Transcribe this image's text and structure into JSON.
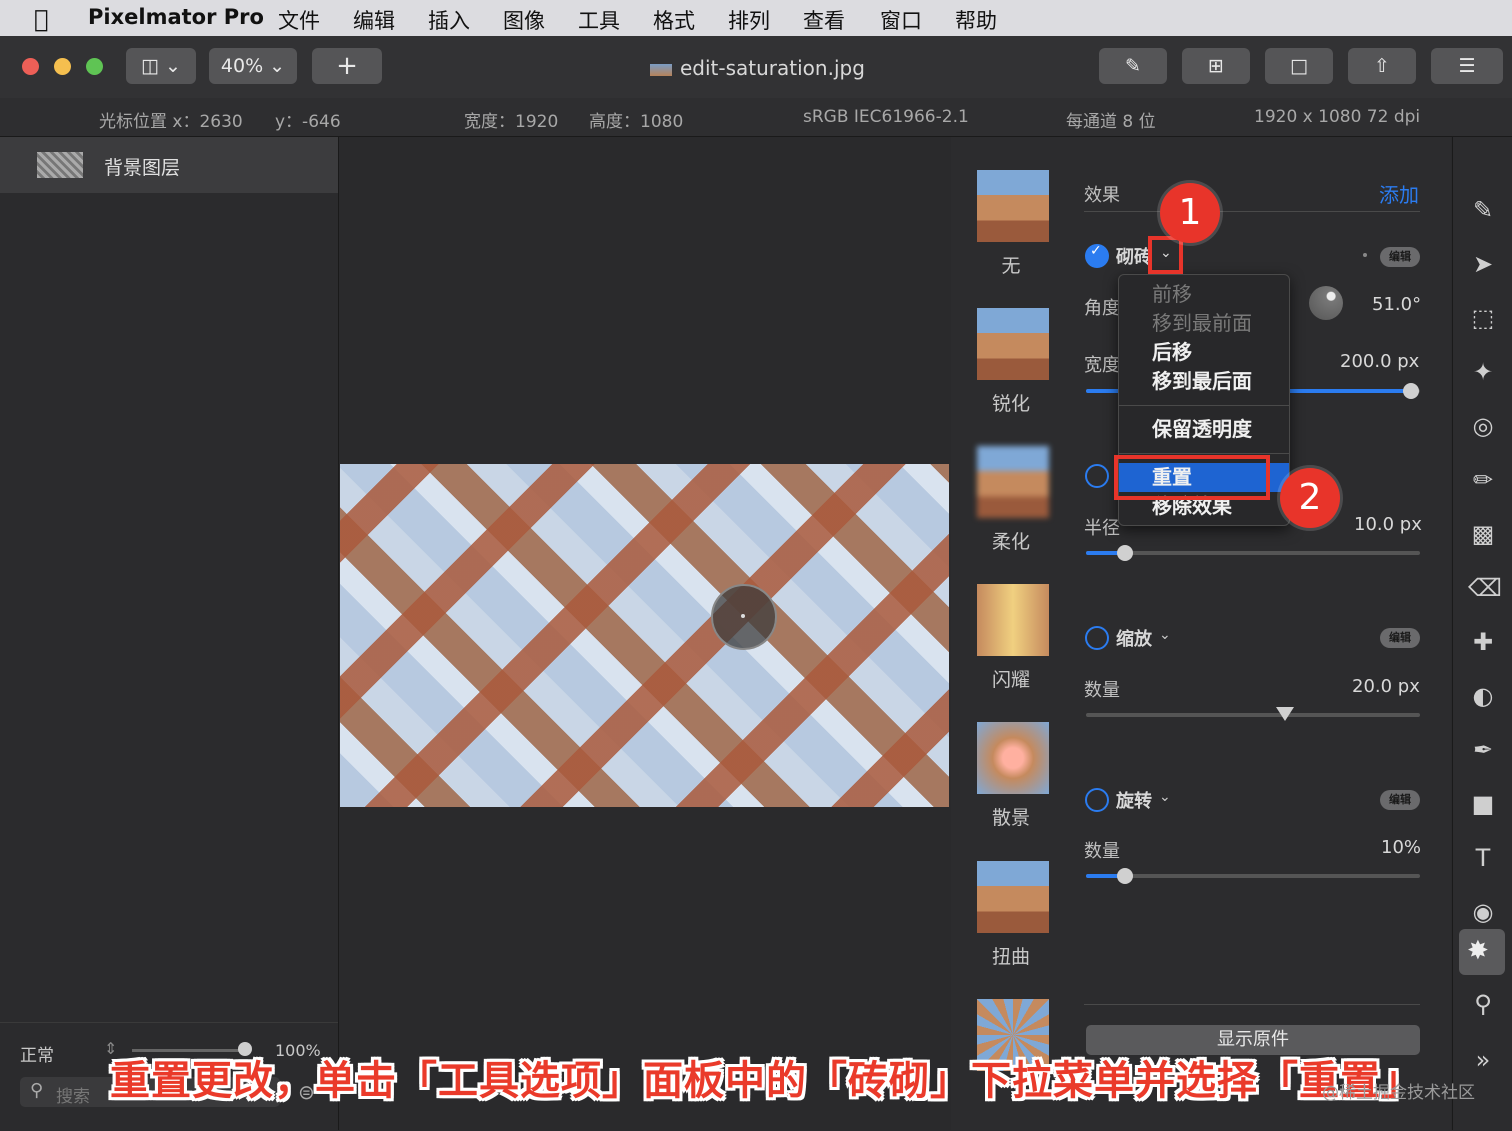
{
  "menubar": {
    "app_name": "Pixelmator Pro",
    "items": [
      "文件",
      "编辑",
      "插入",
      "图像",
      "工具",
      "格式",
      "排列",
      "查看",
      "窗口",
      "帮助"
    ]
  },
  "toolbar": {
    "zoom": "40%",
    "add": "+",
    "document_title": "edit-saturation.jpg"
  },
  "infobar": {
    "cursor_x": "光标位置 x：2630",
    "cursor_y": "y：-646",
    "width": "宽度：1920",
    "height": "高度：1080",
    "color_profile": "sRGB IEC61966-2.1",
    "bit_depth": "每通道 8 位",
    "resolution": "1920 x 1080 72 dpi"
  },
  "layers": {
    "layer_name": "背景图层",
    "blend_mode": "正常",
    "opacity": "100%",
    "search_placeholder": "搜索"
  },
  "effects_browser": {
    "items": [
      "无",
      "锐化",
      "柔化",
      "闪耀",
      "散景",
      "扭曲"
    ]
  },
  "options": {
    "header": "效果",
    "add": "添加",
    "effect1_name": "砌砖",
    "edit": "编辑",
    "angle_label": "角度",
    "angle_value": "51.0°",
    "width_label": "宽度",
    "width_value": "200.0 px",
    "radius_label": "半径",
    "radius_value": "10.0 px",
    "zoom_name": "缩放",
    "zoom_amount_label": "数量",
    "zoom_amount_value": "20.0 px",
    "rotate_name": "旋转",
    "rotate_amount_label": "数量",
    "rotate_amount_value": "10%",
    "show_original": "显示原件"
  },
  "context_menu": {
    "forward": "前移",
    "bring_to_front": "移到最前面",
    "backward": "后移",
    "send_to_back": "移到最后面",
    "preserve_transparency": "保留透明度",
    "reset": "重置",
    "remove_effect": "移除效果"
  },
  "annotations": {
    "callout1": "1",
    "callout2": "2",
    "caption": "重置更改，单击「工具选项」面板中的「砖砌」下拉菜单并选择「重置」",
    "watermark": "@稀土掘金技术社区"
  },
  "colors": {
    "accent": "#2b7cf0",
    "annotation_red": "#e8342a",
    "menu_highlight": "#1e64d2"
  }
}
